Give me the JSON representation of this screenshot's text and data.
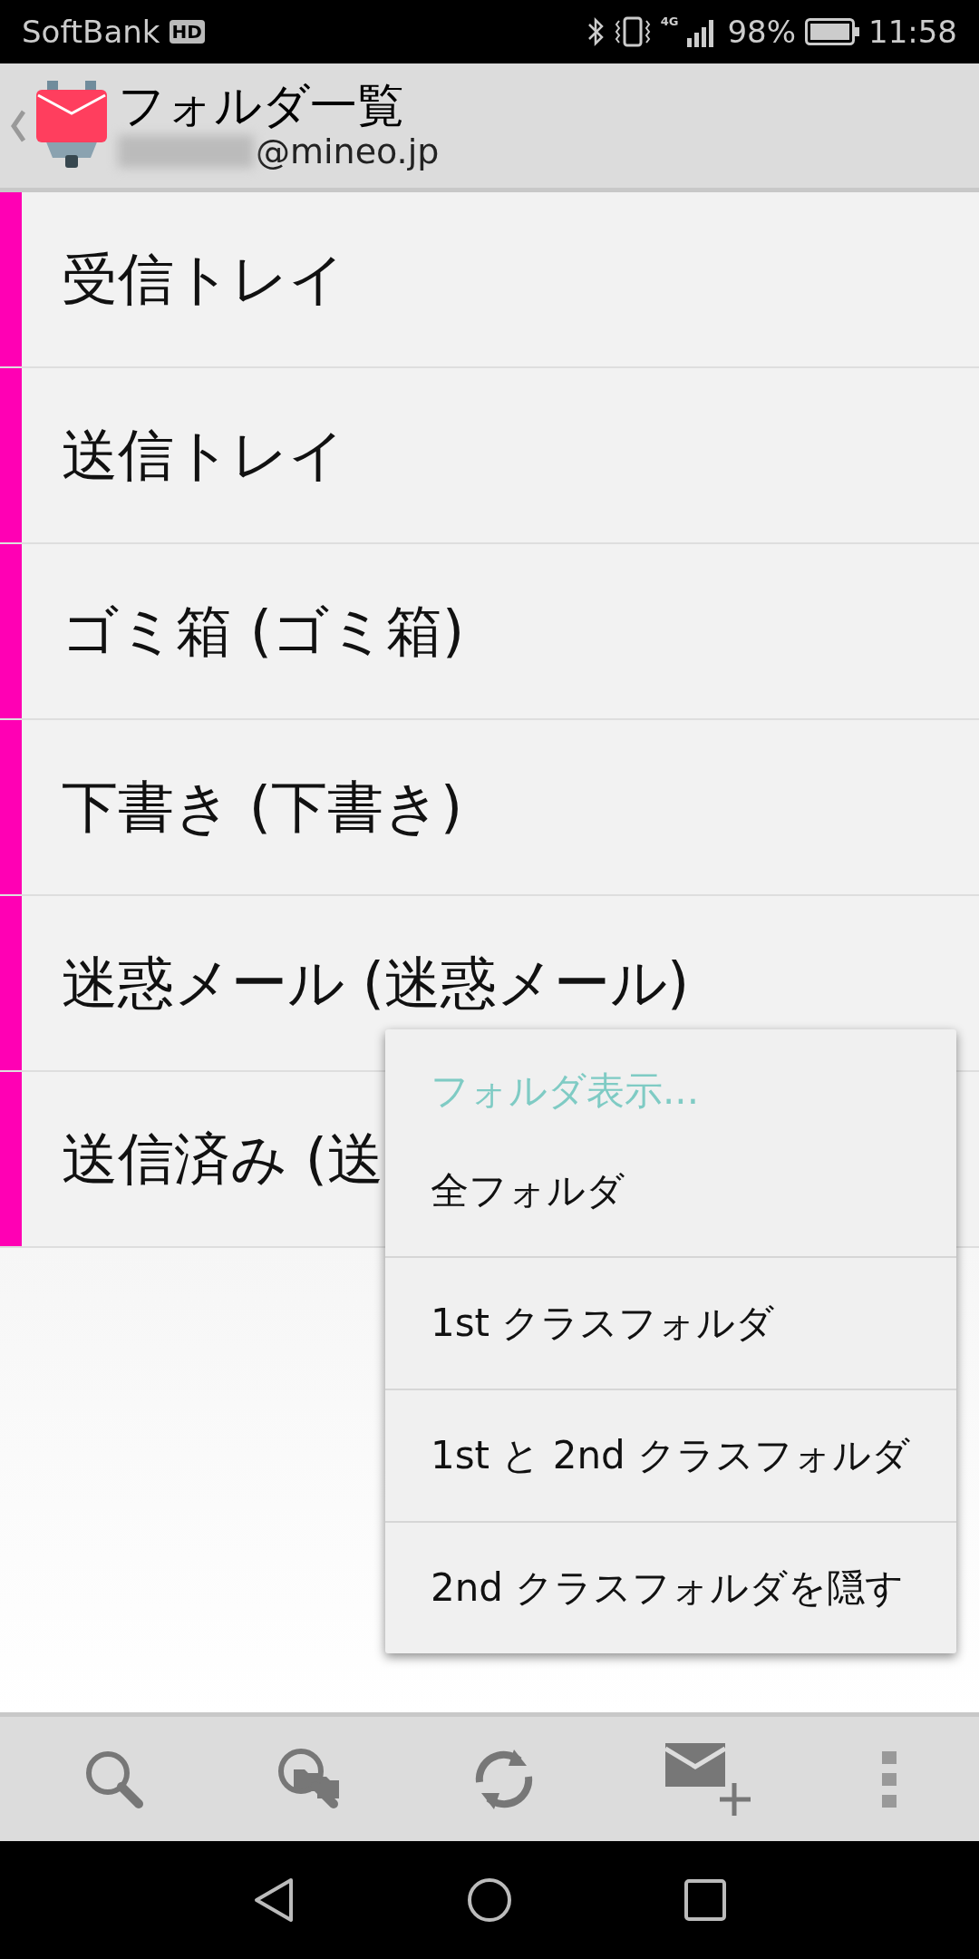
{
  "status_bar": {
    "carrier": "SoftBank",
    "carrier_badge": "HD",
    "network": "4G",
    "battery": "98%",
    "time": "11:58"
  },
  "header": {
    "title": "フォルダ一覧",
    "account": "@mineo.jp"
  },
  "folders": [
    {
      "name": "受信トレイ",
      "color": "#ff00b4"
    },
    {
      "name": "送信トレイ",
      "color": "#ff00b4"
    },
    {
      "name": "ゴミ箱 (ゴミ箱)",
      "color": "#ff00b4"
    },
    {
      "name": "下書き (下書き)",
      "color": "#ff00b4"
    },
    {
      "name": "迷惑メール (迷惑メール)",
      "color": "#ff00b4"
    },
    {
      "name": "送信済み (送",
      "color": "#ff00b4"
    }
  ],
  "menu": {
    "title": "フォルダ表示...",
    "items": [
      "全フォルダ",
      "1st クラスフォルダ",
      "1st と 2nd クラスフォルダ",
      "2nd クラスフォルダを隠す"
    ]
  },
  "toolbar": [
    {
      "kind": "search"
    },
    {
      "kind": "folder-search"
    },
    {
      "kind": "refresh"
    },
    {
      "kind": "compose"
    },
    {
      "kind": "overflow"
    }
  ]
}
